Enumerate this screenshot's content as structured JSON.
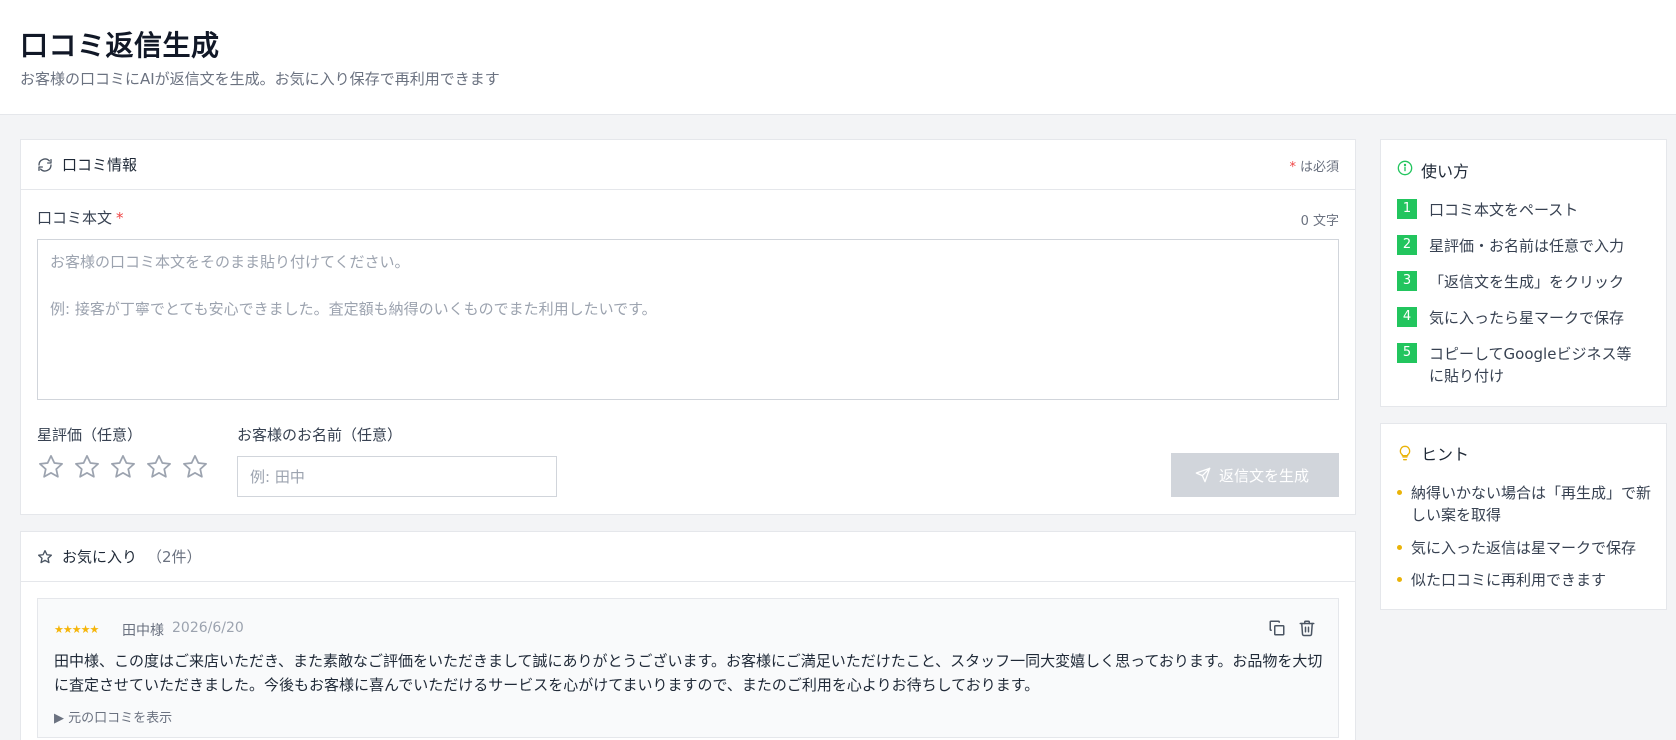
{
  "header": {
    "title": "口コミ返信生成",
    "subtitle": "お客様の口コミにAIが返信文を生成。お気に入り保存で再利用できます"
  },
  "review_form": {
    "title": "口コミ情報",
    "required_mark": "*",
    "required_note": "は必須",
    "body_label": "口コミ本文",
    "body_required": "*",
    "char_count": "0 文字",
    "body_placeholder_line1": "お客様の口コミ本文をそのまま貼り付けてください。",
    "body_placeholder_line2": "例: 接客が丁寧でとても安心できました。査定額も納得のいくものでまた利用したいです。",
    "body_value": "",
    "rating_label": "星評価（任意）",
    "rating_value": 0,
    "rating_max": 5,
    "name_label": "お客様のお名前（任意）",
    "name_placeholder": "例: 田中",
    "name_value": "",
    "generate_label": "返信文を生成",
    "generate_enabled": false
  },
  "favorites": {
    "title": "お気に入り",
    "count_label": "（2件）",
    "items": [
      {
        "stars": "★★★★★",
        "rating": 5,
        "name": "田中様",
        "date": "2026/6/20",
        "text": "田中様、この度はご来店いただき、また素敵なご評価をいただきまして誠にありがとうございます。お客様にご満足いただけたこと、スタッフ一同大変嬉しく思っております。お品物を大切に査定させていただきました。今後もお客様に喜んでいただけるサービスを心がけてまいりますので、またのご利用を心よりお待ちしております。",
        "show_original_label": "元の口コミを表示"
      }
    ]
  },
  "howto": {
    "title": "使い方",
    "steps": [
      {
        "num": "1",
        "text": "口コミ本文をペースト"
      },
      {
        "num": "2",
        "text": "星評価・お名前は任意で入力"
      },
      {
        "num": "3",
        "text": "「返信文を生成」をクリック"
      },
      {
        "num": "4",
        "text": "気に入ったら星マークで保存"
      },
      {
        "num": "5",
        "text": "コピーしてGoogleビジネス等に貼り付け"
      }
    ]
  },
  "hints": {
    "title": "ヒント",
    "items": [
      "納得いかない場合は「再生成」で新しい案を取得",
      "気に入った返信は星マークで保存",
      "似た口コミに再利用できます"
    ]
  },
  "colors": {
    "accent_green": "#22c55e",
    "hint_yellow": "#eab308",
    "required_red": "#ef4444",
    "star_gold": "#f5b50a",
    "disabled_button": "#d1d5db"
  }
}
